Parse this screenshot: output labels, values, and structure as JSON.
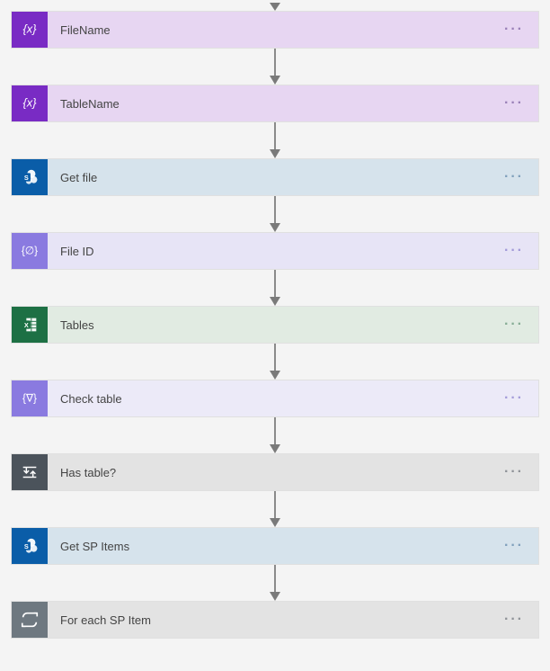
{
  "steps": [
    {
      "label": "FileName",
      "theme": "var",
      "icon": "variable"
    },
    {
      "label": "TableName",
      "theme": "var",
      "icon": "variable"
    },
    {
      "label": "Get file",
      "theme": "sp",
      "icon": "sharepoint"
    },
    {
      "label": "File ID",
      "theme": "compose",
      "icon": "compose"
    },
    {
      "label": "Tables",
      "theme": "excel",
      "icon": "excel"
    },
    {
      "label": "Check table",
      "theme": "filter",
      "icon": "filter"
    },
    {
      "label": "Has table?",
      "theme": "cond",
      "icon": "condition"
    },
    {
      "label": "Get SP Items",
      "theme": "sp",
      "icon": "sharepoint"
    },
    {
      "label": "For each SP Item",
      "theme": "loop",
      "icon": "loop"
    }
  ],
  "menu_glyph": "···"
}
